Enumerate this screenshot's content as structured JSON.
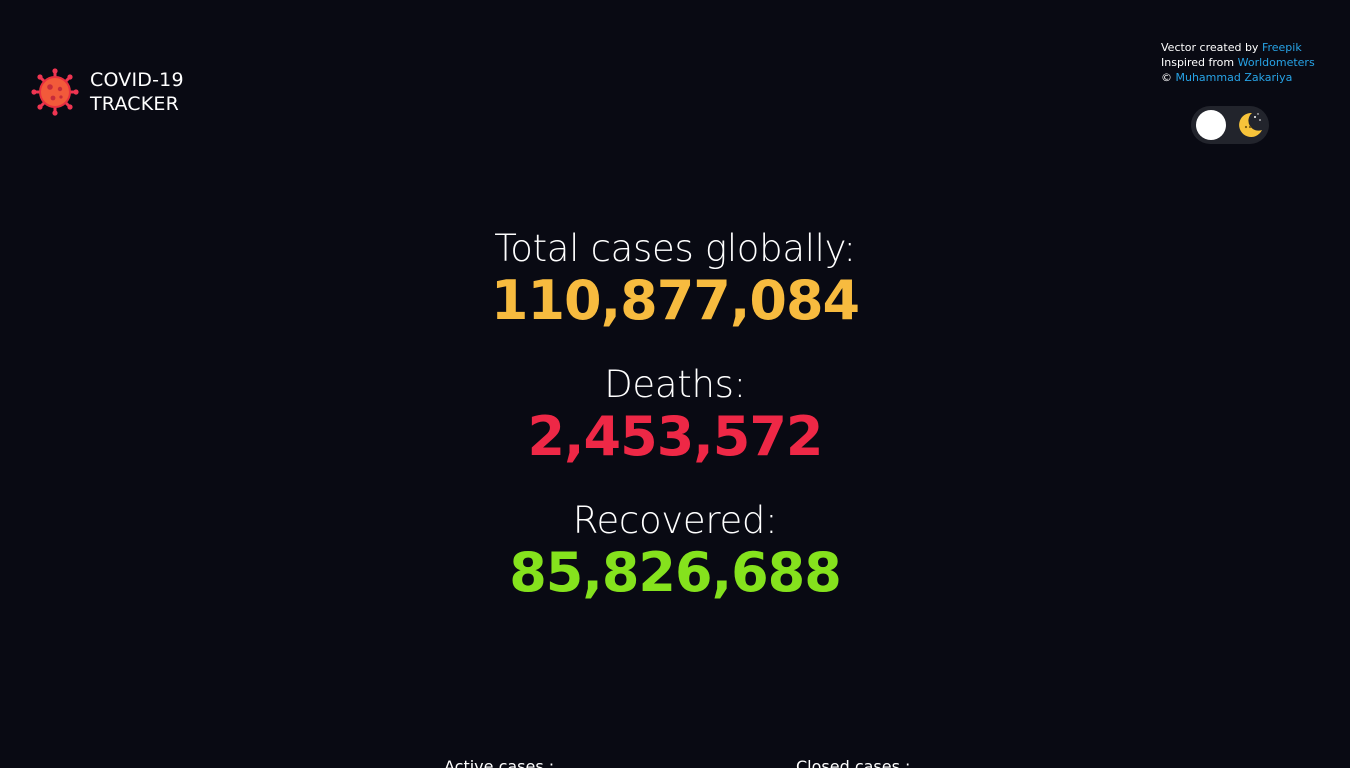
{
  "brand": {
    "title_line1": "COVID-19",
    "title_line2": "TRACKER",
    "icon": "virus-icon"
  },
  "credits": {
    "line1_prefix": "Vector created by ",
    "line1_link": "Freepik",
    "line2_prefix": "Inspired from ",
    "line2_link": "Worldometers",
    "line3_prefix": "© ",
    "line3_link": "Muhammad Zakariya"
  },
  "theme_toggle": {
    "state": "dark",
    "icon": "moon-icon"
  },
  "stats": {
    "total_cases_label": "Total cases globally:",
    "total_cases_value": "110,877,084",
    "deaths_label": "Deaths:",
    "deaths_value": "2,453,572",
    "recovered_label": "Recovered:",
    "recovered_value": "85,826,688"
  },
  "sections": {
    "active_cases_label": "Active cases :",
    "closed_cases_label": "Closed cases :"
  },
  "colors": {
    "background": "#090a13",
    "cases": "#f7bb3f",
    "deaths": "#ee2846",
    "recovered": "#85e21d",
    "link": "#27a3e6"
  }
}
